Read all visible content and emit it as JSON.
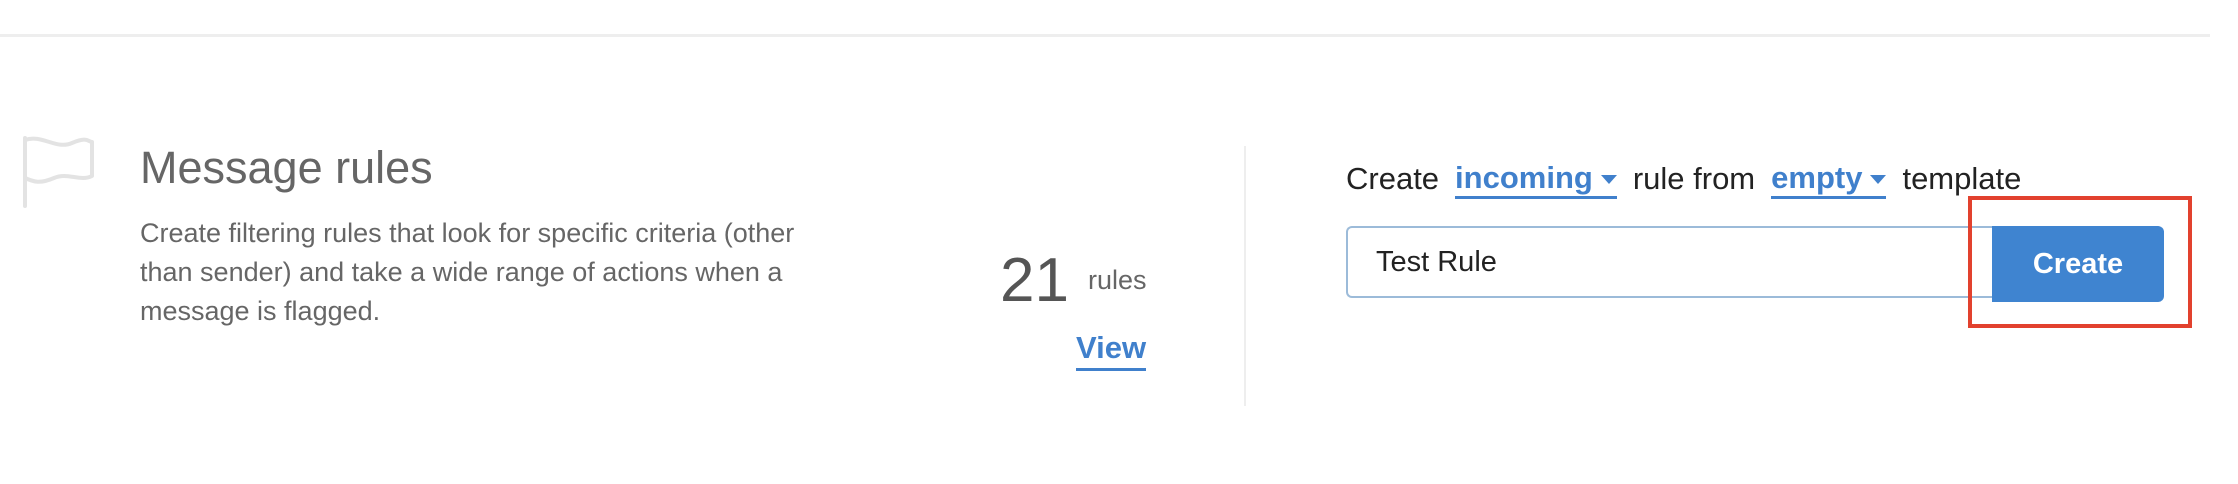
{
  "section": {
    "title": "Message rules",
    "description": "Create filtering rules that look for specific criteria (other than sender) and take a wide range of actions when a message is flagged.",
    "icon": "flag-icon"
  },
  "stats": {
    "count": "21",
    "unit": "rules",
    "view_label": "View"
  },
  "create_form": {
    "prefix": "Create",
    "rule_type": "incoming",
    "middle": "rule from",
    "template": "empty",
    "suffix": "template",
    "name_value": "Test Rule",
    "button_label": "Create"
  },
  "colors": {
    "accent": "#3f84d0",
    "link": "#4080cc",
    "highlight": "#e2412e"
  }
}
